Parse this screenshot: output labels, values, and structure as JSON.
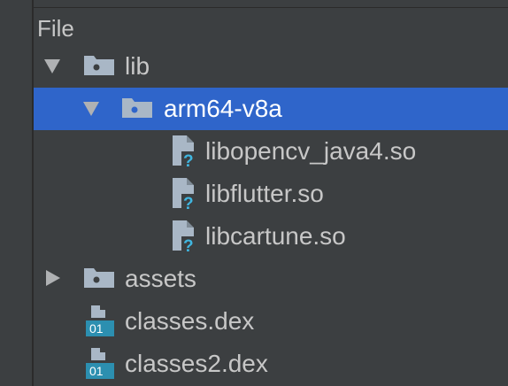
{
  "panel": {
    "header": "File"
  },
  "tree": {
    "lib": {
      "label": "lib",
      "icon": "folder-icon",
      "state": "expanded"
    },
    "arm64": {
      "label": "arm64-v8a",
      "icon": "folder-icon",
      "state": "expanded",
      "selected": true
    },
    "file1": {
      "label": "libopencv_java4.so",
      "icon": "unknown-file-icon"
    },
    "file2": {
      "label": "libflutter.so",
      "icon": "unknown-file-icon"
    },
    "file3": {
      "label": "libcartune.so",
      "icon": "unknown-file-icon"
    },
    "assets": {
      "label": "assets",
      "icon": "folder-icon",
      "state": "collapsed"
    },
    "dex1": {
      "label": "classes.dex",
      "icon": "dex-file-icon",
      "badge": "01"
    },
    "dex2": {
      "label": "classes2.dex",
      "icon": "dex-file-icon",
      "badge": "01"
    }
  },
  "colors": {
    "background": "#3c3f41",
    "selection": "#2f65ca",
    "text": "#c7c7c7",
    "icon": "#a9b7c6",
    "dex_badge": "#40b6e0"
  }
}
